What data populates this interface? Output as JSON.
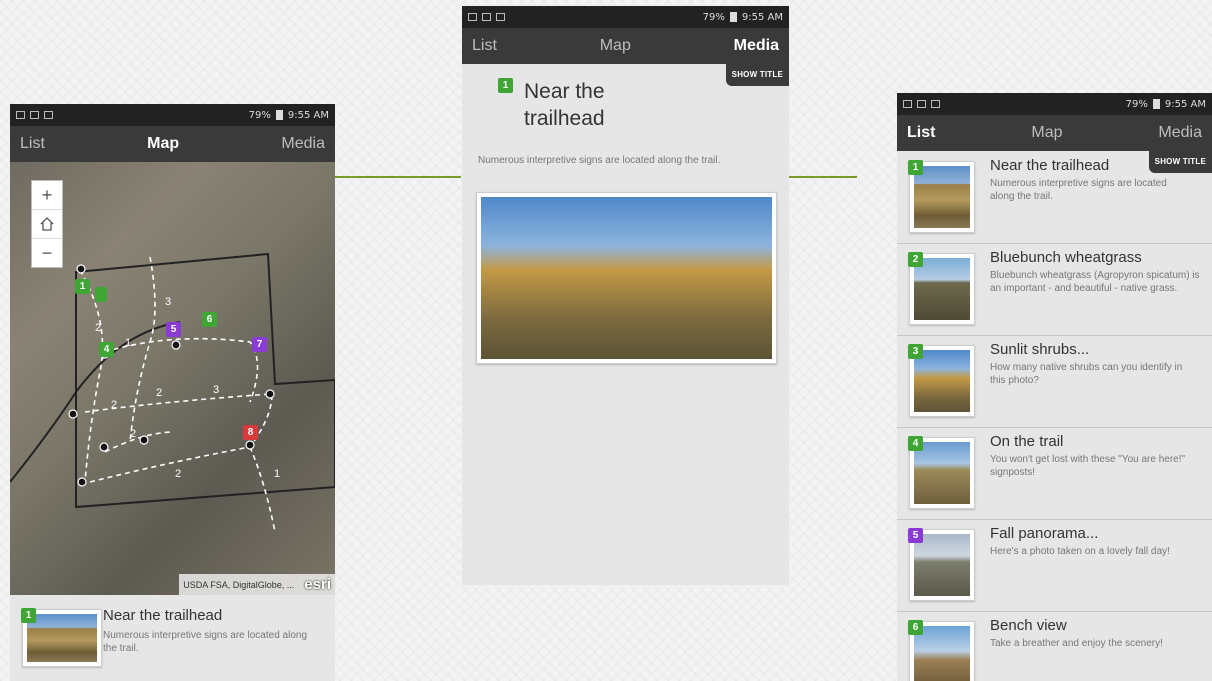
{
  "status": {
    "battery": "79%",
    "time": "9:55 AM"
  },
  "tabs": {
    "list": "List",
    "map": "Map",
    "media": "Media"
  },
  "show_title": "SHOW TITLE",
  "map_phone": {
    "zoom_in": "+",
    "zoom_out": "−",
    "attribution": "USDA FSA, DigitalGlobe, ...",
    "esri": "esri",
    "card": {
      "number": "1",
      "title": "Near the trailhead",
      "description": "Numerous interpretive signs are located along the trail."
    }
  },
  "media_phone": {
    "number": "1",
    "title": "Near the trailhead",
    "description": "Numerous interpretive signs are located along the trail."
  },
  "list_phone": {
    "items": [
      {
        "number": "1",
        "color": "green",
        "title": "Near the trailhead",
        "description": "Numerous interpretive signs are located along the trail."
      },
      {
        "number": "2",
        "color": "green",
        "title": "Bluebunch wheatgrass",
        "description": "Bluebunch wheatgrass (Agropyron spicatum) is an important - and beautiful - native grass."
      },
      {
        "number": "3",
        "color": "green",
        "title": "Sunlit shrubs...",
        "description": "How many native shrubs can you identify in this photo?"
      },
      {
        "number": "4",
        "color": "green",
        "title": "On the trail",
        "description": "You won't get lost with these \"You are here!\" signposts!"
      },
      {
        "number": "5",
        "color": "purple",
        "title": "Fall panorama...",
        "description": "Here's a photo taken on a lovely fall day!"
      },
      {
        "number": "6",
        "color": "green",
        "title": "Bench view",
        "description": "Take a breather and enjoy the scenery!"
      }
    ]
  },
  "map_pins": [
    {
      "number": "1",
      "color": "green"
    },
    {
      "number": "5",
      "color": "purple"
    },
    {
      "number": "6",
      "color": "green"
    },
    {
      "number": "4",
      "color": "green"
    },
    {
      "number": "7",
      "color": "purple"
    },
    {
      "number": "8",
      "color": "red"
    }
  ],
  "trail_labels": [
    "1",
    "2",
    "2",
    "3",
    "2",
    "2",
    "2",
    "1",
    "3"
  ],
  "colors": {
    "accent": "#7a9a2a",
    "appbar": "#3a3a3a",
    "pin_green": "#3fa535",
    "pin_purple": "#8a3bd6",
    "pin_red": "#d93a3a"
  }
}
